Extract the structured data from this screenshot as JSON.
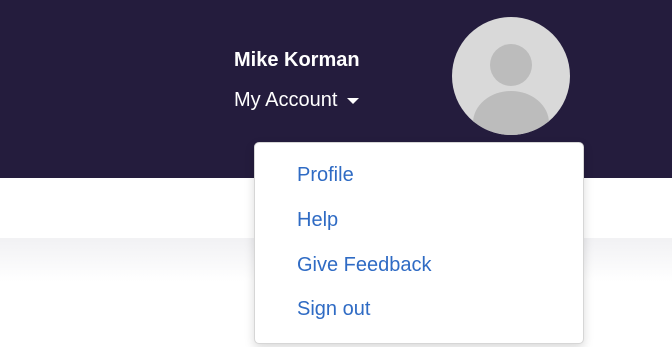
{
  "user": {
    "name": "Mike Korman",
    "account_label": "My Account"
  },
  "colors": {
    "header_bg": "#241c3d",
    "link": "#2f6bc4",
    "avatar_bg": "#d9d9d9"
  },
  "icons": {
    "avatar": "user-silhouette-icon",
    "caret": "caret-down-icon"
  },
  "menu": {
    "items": [
      {
        "label": "Profile"
      },
      {
        "label": "Help"
      },
      {
        "label": "Give Feedback"
      },
      {
        "label": "Sign out"
      }
    ]
  }
}
